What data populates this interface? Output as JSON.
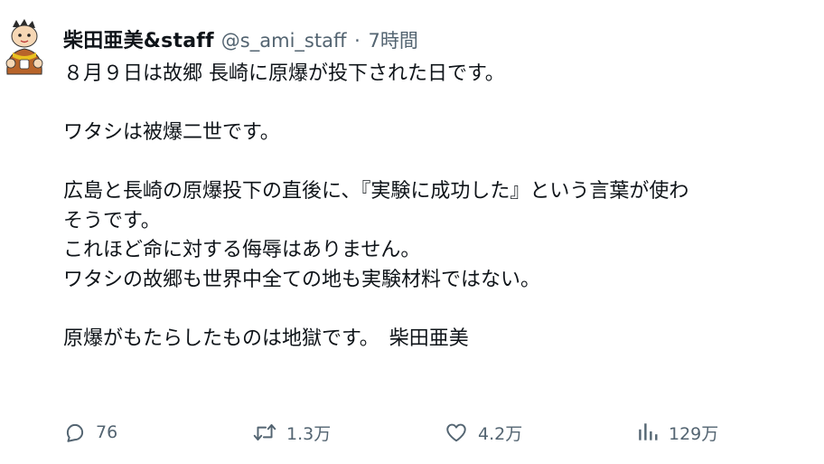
{
  "tweet": {
    "author": {
      "display_name": "柴田亜美&staff",
      "handle": "@s_ami_staff",
      "separator": "·",
      "time": "7時間",
      "avatar_icon": "cartoon-avatar-icon"
    },
    "lines": [
      "８月９日は故郷 長崎に原爆が投下された日です。",
      "",
      "ワタシは被爆二世です。",
      "",
      "広島と長崎の原爆投下の直後に、『実験に成功した』という言葉が使わ",
      "そうです。",
      "これほど命に対する侮辱はありません。",
      "ワタシの故郷も世界中全ての地も実験材料ではない。",
      "",
      "原爆がもたらしたものは地獄です。　柴田亜美"
    ],
    "actions": {
      "reply": {
        "icon": "reply-icon",
        "count": "76"
      },
      "retweet": {
        "icon": "retweet-icon",
        "count": "1.3万"
      },
      "like": {
        "icon": "heart-icon",
        "count": "4.2万"
      },
      "views": {
        "icon": "views-icon",
        "count": "129万"
      }
    },
    "colors": {
      "text": "#0f1419",
      "secondary": "#536471",
      "background": "#ffffff"
    }
  }
}
